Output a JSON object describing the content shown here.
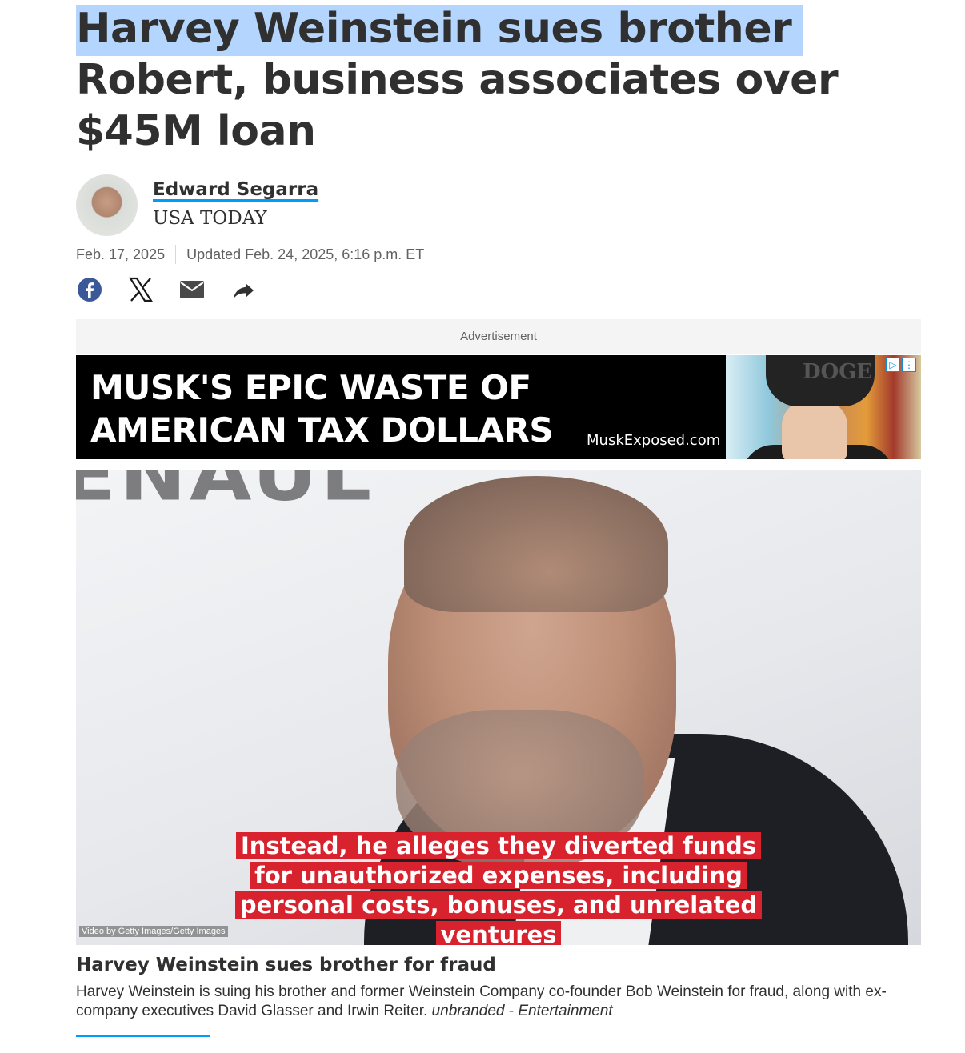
{
  "article": {
    "headline_line1": "Harvey Weinstein sues brother",
    "headline_rest": "Robert, business associates over $45M loan"
  },
  "byline": {
    "author_name": "Edward Segarra",
    "publication": "USA TODAY",
    "date_published": "Feb. 17, 2025",
    "date_updated": "Updated Feb. 24, 2025, 6:16 p.m. ET"
  },
  "share": {
    "icons": [
      "facebook-icon",
      "x-icon",
      "email-icon",
      "share-icon"
    ]
  },
  "ad": {
    "label": "Advertisement",
    "line1": "MUSK'S EPIC WASTE OF",
    "line2": "AMERICAN TAX DOLLARS",
    "domain": "MuskExposed.com",
    "cap_text": "DOGE",
    "choices_icon": "▷",
    "menu_icon": "⋮"
  },
  "video": {
    "bg_text": "ENAUL",
    "caption": "Instead, he alleges they diverted funds for unauthorized expenses, including personal costs, bonuses, and unrelated ventures",
    "credit": "Video by Getty Images/Getty Images",
    "title": "Harvey Weinstein sues brother for fraud",
    "description": "Harvey Weinstein is suing his brother and former Weinstein Company co-founder Bob Weinstein for fraud, along with ex-company executives David Glasser and Irwin Reiter.",
    "source": "unbranded - Entertainment"
  },
  "colors": {
    "link_accent": "#009bff",
    "selection_highlight": "#b4d5fe",
    "caption_red": "#d8232f",
    "facebook_blue": "#3b5998"
  }
}
